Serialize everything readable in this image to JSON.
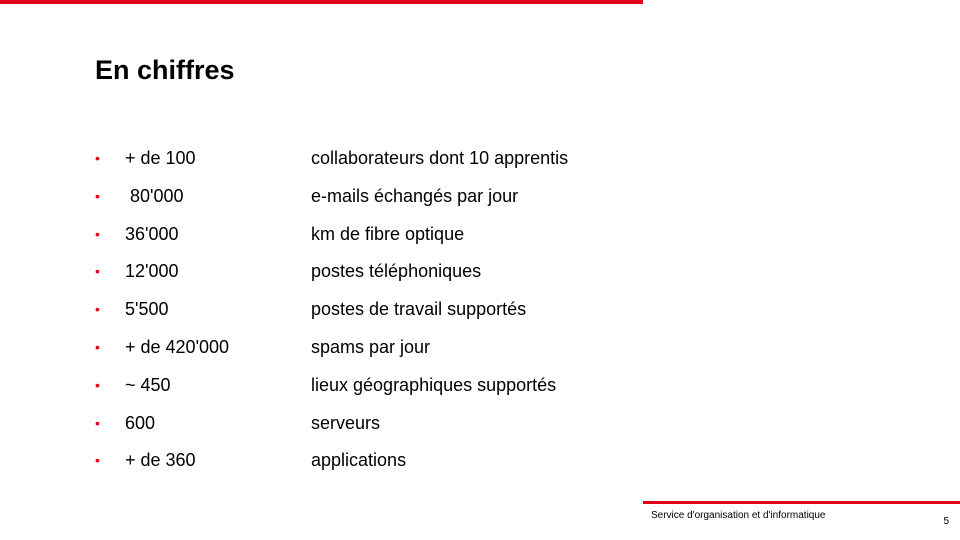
{
  "slide": {
    "title": "En chiffres",
    "bullet_glyph": "•",
    "accent_color": "#e2001a",
    "items": [
      {
        "value": "+ de 100",
        "desc": "collaborateurs dont 10 apprentis"
      },
      {
        "value": " 80'000",
        "desc": "e-mails échangés par jour"
      },
      {
        "value": "36'000",
        "desc": "km de fibre optique"
      },
      {
        "value": "12'000",
        "desc": "postes téléphoniques"
      },
      {
        "value": "5'500",
        "desc": "postes de travail supportés"
      },
      {
        "value": "+ de 420'000",
        "desc": "spams par jour"
      },
      {
        "value": "~ 450",
        "desc": "lieux géographiques supportés"
      },
      {
        "value": "600",
        "desc": "serveurs"
      },
      {
        "value": "+ de 360",
        "desc": "applications"
      }
    ]
  },
  "footer": {
    "organization": "Service d'organisation et d'informatique",
    "page_number": "5"
  }
}
